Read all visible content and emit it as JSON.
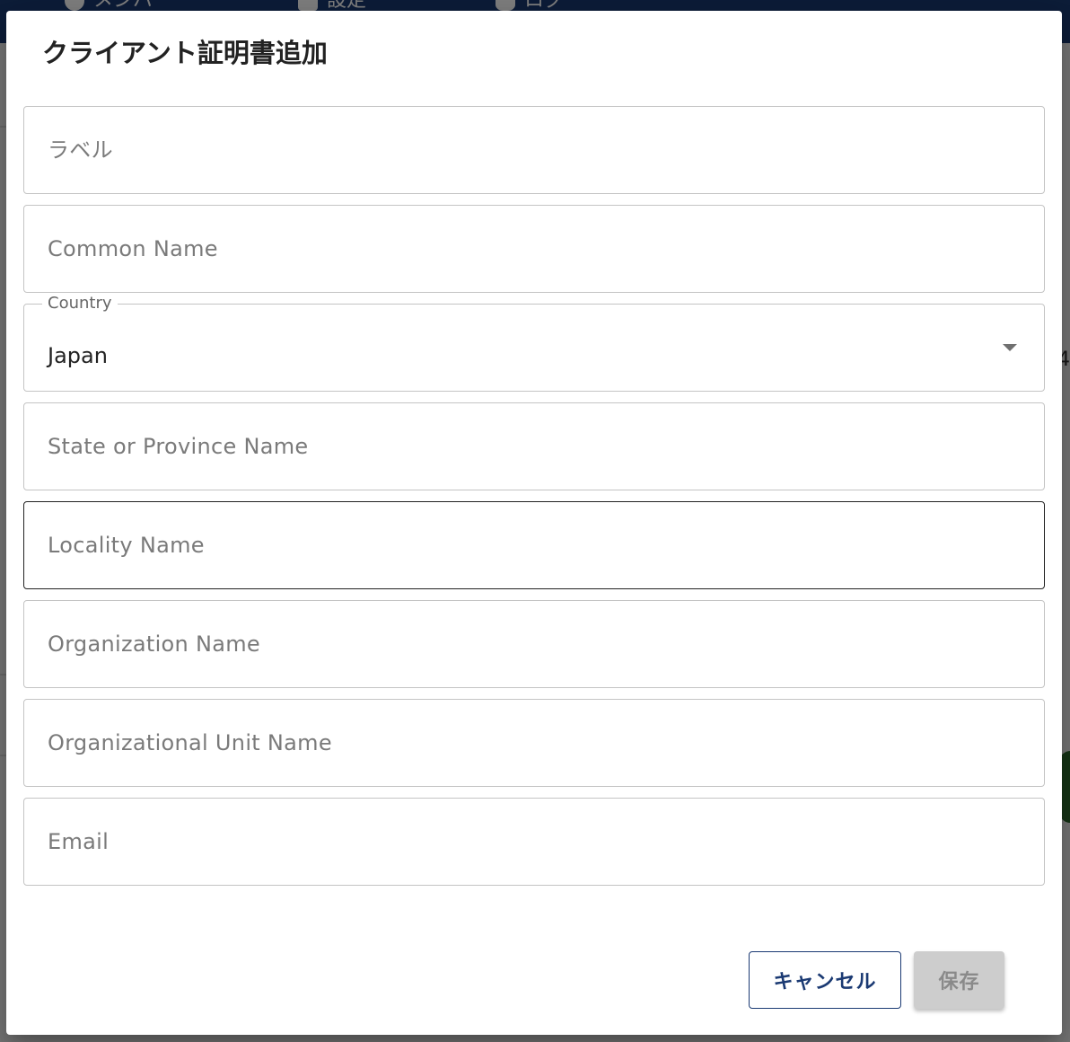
{
  "background": {
    "nav_items": [
      {
        "label": "メンバー",
        "icon": "person-icon"
      },
      {
        "label": "設定",
        "icon": "gear-icon"
      },
      {
        "label": "ログ",
        "icon": "database-icon"
      }
    ],
    "right_glyph": "4",
    "colors": {
      "nav": "#1b3a73",
      "scrim": "rgba(0,0,0,0.5)"
    }
  },
  "dialog": {
    "title": "クライアント証明書追加",
    "fields": {
      "label": {
        "placeholder": "ラベル"
      },
      "common_name": {
        "placeholder": "Common Name"
      },
      "country": {
        "legend": "Country",
        "value": "Japan",
        "icon": "caret-down-icon"
      },
      "state": {
        "placeholder": "State or Province Name"
      },
      "locality": {
        "placeholder": "Locality Name"
      },
      "organization": {
        "placeholder": "Organization Name"
      },
      "organizational_unit": {
        "placeholder": "Organizational Unit Name"
      },
      "email": {
        "placeholder": "Email"
      }
    },
    "actions": {
      "cancel_label": "キャンセル",
      "save_label": "保存"
    },
    "colors": {
      "primary": "#1b3a73",
      "disabled_bg": "#cdcdcd",
      "disabled_text": "#8a8a8a"
    }
  }
}
